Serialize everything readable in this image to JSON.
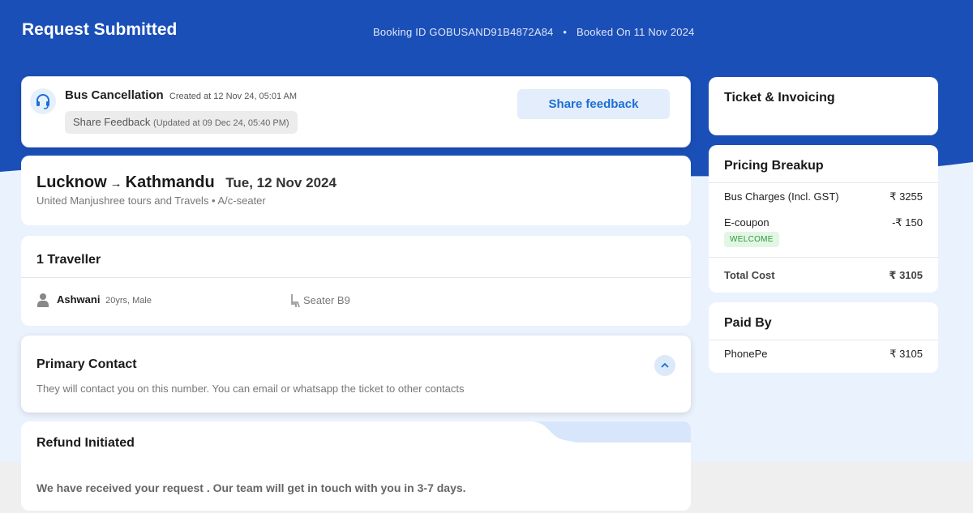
{
  "header": {
    "title": "Request Submitted",
    "booking_id": "Booking ID GOBUSAND91B4872A84",
    "separator": "•",
    "booked_on": "Booked On 11 Nov 2024"
  },
  "cancellation": {
    "icon": "headset-icon",
    "title": "Bus Cancellation",
    "created": "Created at 12 Nov 24, 05:01 AM",
    "status_label": "Share Feedback",
    "status_updated": "(Updated at 09 Dec 24, 05:40 PM)",
    "button_label": "Share feedback"
  },
  "trip": {
    "from": "Lucknow",
    "arrow": "→",
    "to": "Kathmandu",
    "date": "Tue, 12 Nov 2024",
    "operator": "United Manjushree tours and Travels • A/c-seater"
  },
  "travellers": {
    "title": "1 Traveller",
    "items": [
      {
        "name": "Ashwani",
        "details": "20yrs, Male",
        "seat": "Seater B9"
      }
    ]
  },
  "contact": {
    "title": "Primary Contact",
    "description": "They will contact you on this number. You can email or whatsapp the ticket to other contacts"
  },
  "refund": {
    "title": "Refund Initiated",
    "message": "We have received your request . Our team will get in touch with you in 3-7 days."
  },
  "ticket": {
    "title": "Ticket & Invoicing"
  },
  "pricing": {
    "title": "Pricing Breakup",
    "rows": [
      {
        "label": "Bus Charges (Incl. GST)",
        "value": "₹ 3255"
      },
      {
        "label": "E-coupon",
        "value": "-₹ 150"
      }
    ],
    "coupon_code": "WELCOME",
    "total_label": "Total Cost",
    "total_value": "₹ 3105"
  },
  "payment": {
    "title": "Paid By",
    "method": "PhonePe",
    "amount": "₹ 3105"
  },
  "colors": {
    "brand_blue": "#1b4fb8",
    "link_blue": "#1c6ed4",
    "success_green": "#2c9a3a"
  }
}
